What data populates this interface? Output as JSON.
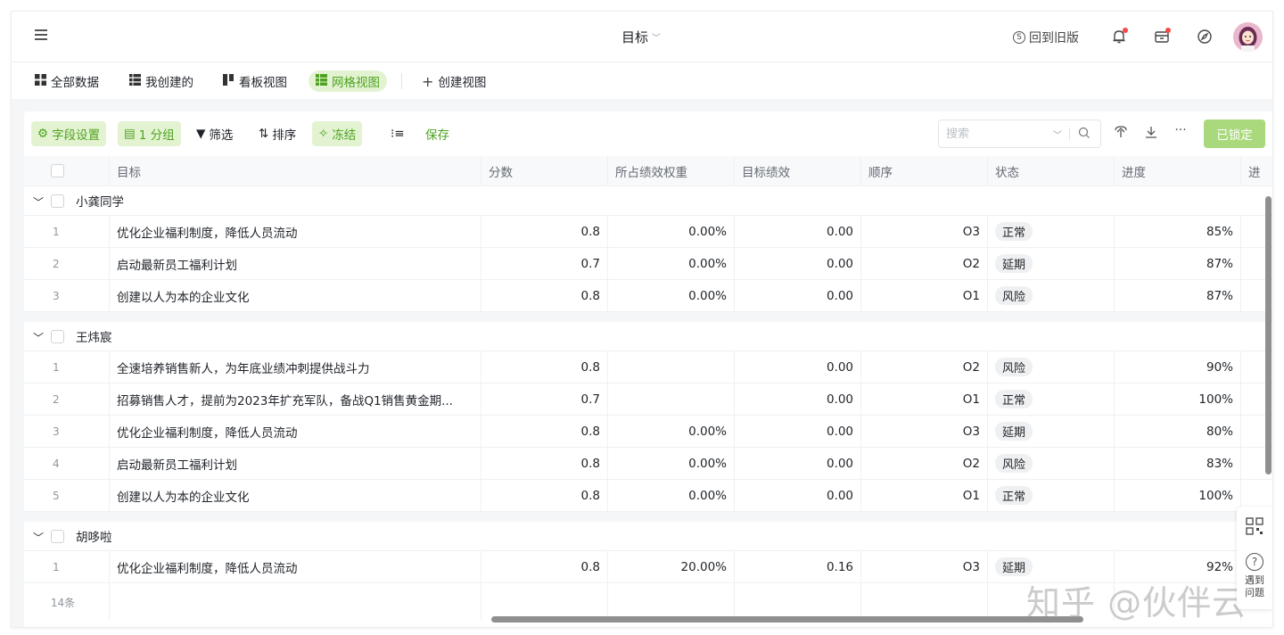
{
  "header": {
    "title": "目标",
    "old_version": "回到旧版",
    "old_version_icon": "S"
  },
  "views": [
    {
      "label": "全部数据",
      "icon": "grid-icon"
    },
    {
      "label": "我创建的",
      "icon": "list-icon"
    },
    {
      "label": "看板视图",
      "icon": "kanban-icon"
    },
    {
      "label": "网格视图",
      "icon": "table-icon",
      "active": true
    },
    {
      "label": "创建视图",
      "icon": "plus-icon"
    }
  ],
  "toolbar": {
    "field_settings": "字段设置",
    "group": "1 分组",
    "filter": "筛选",
    "sort": "排序",
    "freeze": "冻结",
    "save": "保存",
    "search_placeholder": "搜索",
    "locked": "已锁定"
  },
  "columns": [
    "目标",
    "分数",
    "所占绩效权重",
    "目标绩效",
    "顺序",
    "状态",
    "进度",
    "进"
  ],
  "groups": [
    {
      "name": "小龚同学",
      "rows": [
        {
          "idx": "1",
          "goal": "优化企业福利制度，降低人员流动",
          "score": "0.8",
          "weight": "0.00%",
          "perf": "0.00",
          "order": "O3",
          "status": "正常",
          "progress": "85%"
        },
        {
          "idx": "2",
          "goal": "启动最新员工福利计划",
          "score": "0.7",
          "weight": "0.00%",
          "perf": "0.00",
          "order": "O2",
          "status": "延期",
          "progress": "87%"
        },
        {
          "idx": "3",
          "goal": "创建以人为本的企业文化",
          "score": "0.8",
          "weight": "0.00%",
          "perf": "0.00",
          "order": "O1",
          "status": "风险",
          "progress": "87%"
        }
      ]
    },
    {
      "name": "王炜宸",
      "rows": [
        {
          "idx": "1",
          "goal": "全速培养销售新人，为年底业绩冲刺提供战斗力",
          "score": "0.8",
          "weight": "",
          "perf": "0.00",
          "order": "O2",
          "status": "风险",
          "progress": "90%"
        },
        {
          "idx": "2",
          "goal": "招募销售人才，提前为2023年扩充军队，备战Q1销售黄金期...",
          "score": "0.7",
          "weight": "",
          "perf": "0.00",
          "order": "O1",
          "status": "正常",
          "progress": "100%"
        },
        {
          "idx": "3",
          "goal": "优化企业福利制度，降低人员流动",
          "score": "0.8",
          "weight": "0.00%",
          "perf": "0.00",
          "order": "O3",
          "status": "延期",
          "progress": "80%"
        },
        {
          "idx": "4",
          "goal": "启动最新员工福利计划",
          "score": "0.8",
          "weight": "0.00%",
          "perf": "0.00",
          "order": "O2",
          "status": "风险",
          "progress": "83%"
        },
        {
          "idx": "5",
          "goal": "创建以人为本的企业文化",
          "score": "0.8",
          "weight": "0.00%",
          "perf": "0.00",
          "order": "O1",
          "status": "正常",
          "progress": "100%"
        }
      ]
    },
    {
      "name": "胡哆啦",
      "rows": [
        {
          "idx": "1",
          "goal": "优化企业福利制度，降低人员流动",
          "score": "0.8",
          "weight": "20.00%",
          "perf": "0.16",
          "order": "O3",
          "status": "延期",
          "progress": "92%"
        }
      ]
    }
  ],
  "footer": {
    "count": "14条"
  },
  "float": {
    "help_text": "遇到问题"
  },
  "watermark": "知乎 @伙伴云",
  "colors": {
    "accent": "#4ea21f",
    "accent_bg": "#e3f3d2",
    "locked_btn": "#a9d97c"
  }
}
